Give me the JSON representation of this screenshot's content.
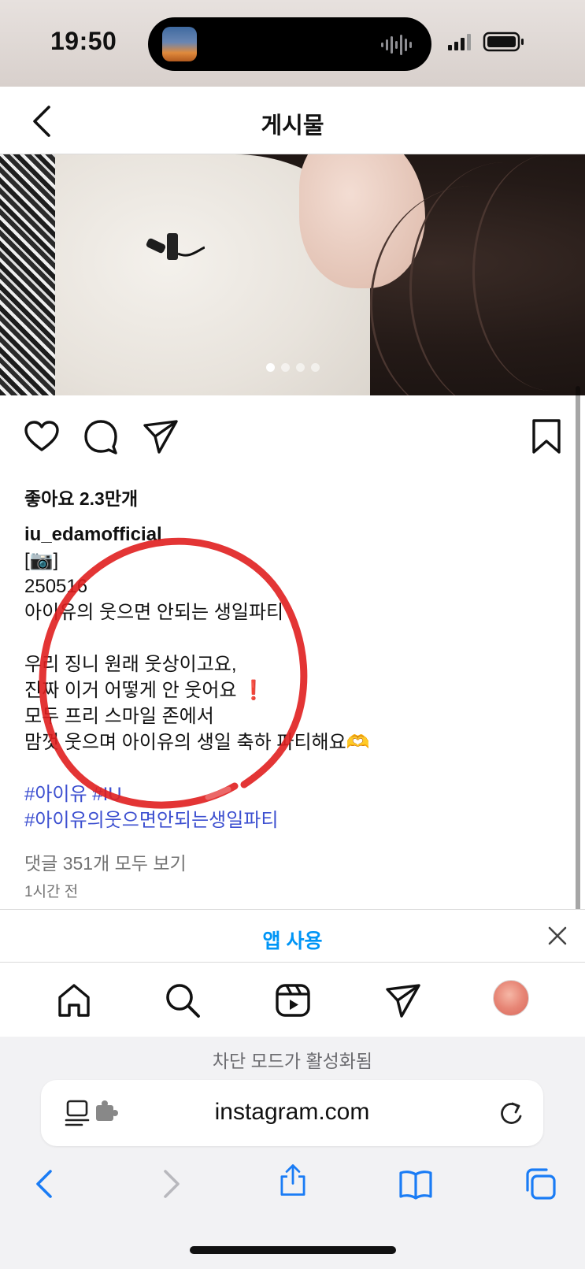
{
  "status_bar": {
    "time": "19:50"
  },
  "header": {
    "title": "게시물"
  },
  "post": {
    "likes": "좋아요 2.3만개",
    "username": "iu_edamofficial",
    "caption_lines": [
      "[📷]",
      "250516",
      "아이유의 웃으면 안되는 생일파티",
      "",
      "우리 징니 원래 웃상이고요,",
      "진짜 이거 어떻게 안 웃어요 ",
      "모두 프리 스마일 존에서",
      "맘껏 웃으며 아이유의 생일 축하 파티해요🫶"
    ],
    "exclamation": "❗",
    "hashtags_line1": "#아이유 #IU",
    "hashtags_line2": "#아이유의웃으면안되는생일파티",
    "comments_link": "댓글 351개 모두 보기",
    "timestamp": "1시간 전",
    "image_count": 4,
    "active_image": 1
  },
  "app_banner": {
    "label": "앱 사용"
  },
  "bottom_nav": {
    "items": [
      "home-icon",
      "search-icon",
      "reels-icon",
      "direct-icon",
      "profile-avatar"
    ]
  },
  "safari": {
    "blocked_notice": "차단 모드가 활성화됨",
    "url": "instagram.com"
  },
  "colors": {
    "accent_blue": "#0095f6",
    "hashtag": "#3c4fd0",
    "annotation_red": "#e01f1f",
    "safari_blue": "#1a7cf5"
  }
}
